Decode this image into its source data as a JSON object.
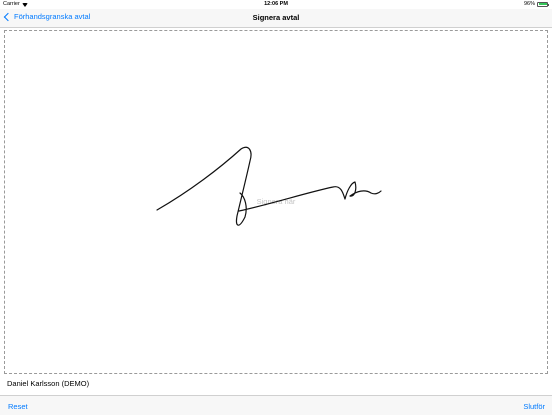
{
  "status_bar": {
    "carrier": "Carrier",
    "time": "12:06 PM",
    "battery": "96%",
    "battery_level": 0.96
  },
  "nav": {
    "back_label": "Förhandsgranska avtal",
    "title": "Signera avtal"
  },
  "signature": {
    "placeholder": "Signera här"
  },
  "signer": {
    "name": "Daniel Karlsson (DEMO)"
  },
  "toolbar": {
    "reset_label": "Reset",
    "finish_label": "Slutför"
  },
  "colors": {
    "accent": "#007aff",
    "battery": "#34c759"
  }
}
